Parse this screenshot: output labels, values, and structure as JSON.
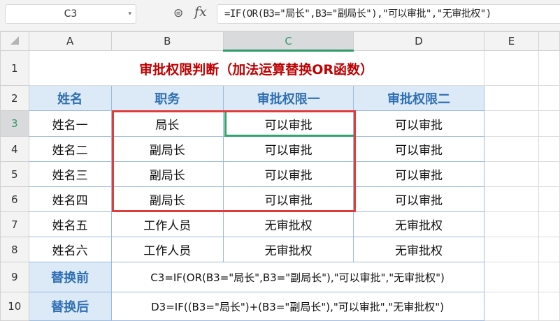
{
  "formula_bar": {
    "cell_ref": "C3",
    "formula": "=IF(OR(B3=\"局长\",B3=\"副局长\"),\"可以审批\",\"无审批权\")"
  },
  "columns": [
    "A",
    "B",
    "C",
    "D",
    "E"
  ],
  "rows": [
    "1",
    "2",
    "3",
    "4",
    "5",
    "6",
    "7",
    "8",
    "9",
    "10"
  ],
  "title": "审批权限判断（加法运算替换OR函数）",
  "headers": [
    "姓名",
    "职务",
    "审批权限一",
    "审批权限二"
  ],
  "data": [
    [
      "姓名一",
      "局长",
      "可以审批",
      "可以审批"
    ],
    [
      "姓名二",
      "副局长",
      "可以审批",
      "可以审批"
    ],
    [
      "姓名三",
      "副局长",
      "可以审批",
      "可以审批"
    ],
    [
      "姓名四",
      "副局长",
      "可以审批",
      "可以审批"
    ],
    [
      "姓名五",
      "工作人员",
      "无审批权",
      "无审批权"
    ],
    [
      "姓名六",
      "工作人员",
      "无审批权",
      "无审批权"
    ]
  ],
  "notes": [
    {
      "label": "替换前",
      "formula": "C3=IF(OR(B3=\"局长\",B3=\"副局长\"),\"可以审批\",\"无审批权\")"
    },
    {
      "label": "替换后",
      "formula": "D3=IF((B3=\"局长\")+(B3=\"副局长\"),\"可以审批\",\"无审批权\")"
    }
  ]
}
